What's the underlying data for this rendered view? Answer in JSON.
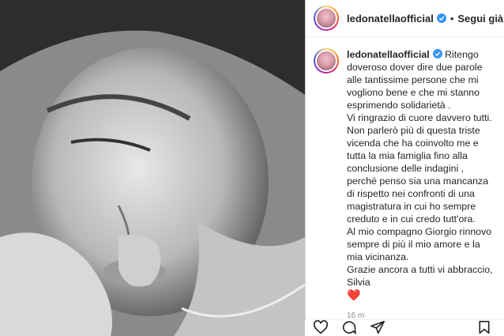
{
  "post": {
    "username": "ledonatella­official",
    "follow_label": "Segui già",
    "separator": "•",
    "caption_lines": [
      "Ritengo doveroso dover dire due parole alle tantissime persone che mi vogliono bene e che mi stanno esprimendo solidarietà .",
      "Vi ringrazio di cuore davvero tutti.",
      "Non parlerò più di questa triste vicenda che ha coinvolto me e tutta la mia famiglia fino alla conclusione delle indagini , perché penso sia una mancanza di rispetto nei confronti di una magistratura in cui ho sempre creduto e in cui credo tutt'ora.",
      "Al mio compagno Giorgio rinnovo sempre di più il mio amore e la mia vicinanza.",
      "Grazie ancora a tutti vi abbraccio, Silvia"
    ],
    "heart_emoji": "❤️",
    "timestamp": "16 m"
  },
  "icons": {
    "verified": "verified-badge-icon",
    "like": "heart-icon",
    "comment": "comment-icon",
    "share": "send-icon",
    "save": "bookmark-icon"
  },
  "colors": {
    "verified": "#3897f0",
    "text": "#262626",
    "muted": "#8e8e8e"
  }
}
